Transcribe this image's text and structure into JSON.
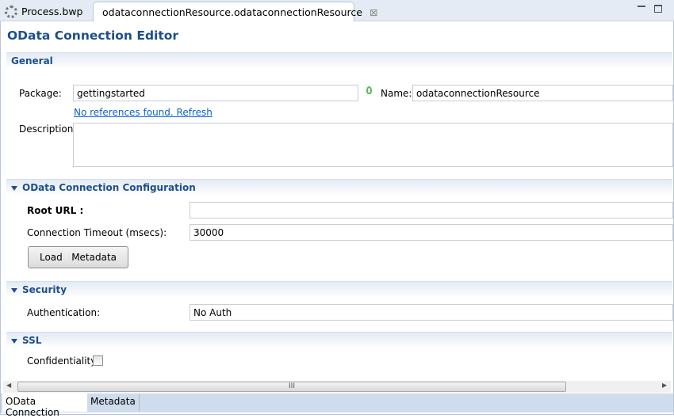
{
  "tabs": [
    {
      "label": "Process.bwp",
      "icon": "gear-icon"
    },
    {
      "label": "odataconnectionResource.odataconnectionResource",
      "icon": "resource-icon",
      "active": true
    }
  ],
  "editor_title": "OData Connection Editor",
  "general": {
    "header": "General",
    "package_label": "Package:",
    "package_value": "gettingstarted",
    "name_label": "Name:",
    "name_value": "odataconnectionResource",
    "refs_link": "No references found. Refresh",
    "description_label": "Description:",
    "description_value": ""
  },
  "config": {
    "header": "OData Connection Configuration",
    "root_url_label": "Root URL :",
    "root_url_value": "",
    "timeout_label": "Connection Timeout (msecs):",
    "timeout_value": "30000",
    "load_button": "Load   Metadata"
  },
  "security": {
    "header": "Security",
    "auth_label": "Authentication:",
    "auth_value": "No Auth"
  },
  "ssl": {
    "header": "SSL",
    "confidentiality_label": "Confidentiality",
    "confidentiality_checked": false
  },
  "scroll_grip": "III",
  "bottom_tabs": [
    {
      "label": "OData Connection",
      "active": true
    },
    {
      "label": "Metadata"
    }
  ],
  "colors": {
    "accent": "#1d4f8a",
    "link": "#0b5fd1"
  }
}
